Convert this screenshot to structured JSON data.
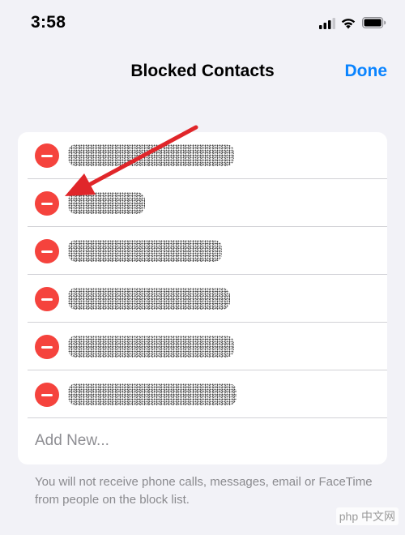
{
  "status_bar": {
    "time": "3:58"
  },
  "nav": {
    "title": "Blocked Contacts",
    "done_label": "Done"
  },
  "contacts": [
    {
      "name": ""
    },
    {
      "name": ""
    },
    {
      "name": ""
    },
    {
      "name": ""
    },
    {
      "name": ""
    },
    {
      "name": ""
    }
  ],
  "add_new": {
    "label": "Add New..."
  },
  "footer": {
    "text": "You will not receive phone calls, messages, email or FaceTime from people on the block list."
  },
  "watermark": {
    "text": "php 中文网"
  },
  "colors": {
    "accent": "#0a84ff",
    "delete": "#f5433d",
    "annotation_arrow": "#e0262a",
    "background": "#f2f2f7"
  },
  "icons": [
    "cellular-signal-icon",
    "wifi-icon",
    "battery-icon",
    "minus-circle-icon",
    "annotation-arrow"
  ]
}
